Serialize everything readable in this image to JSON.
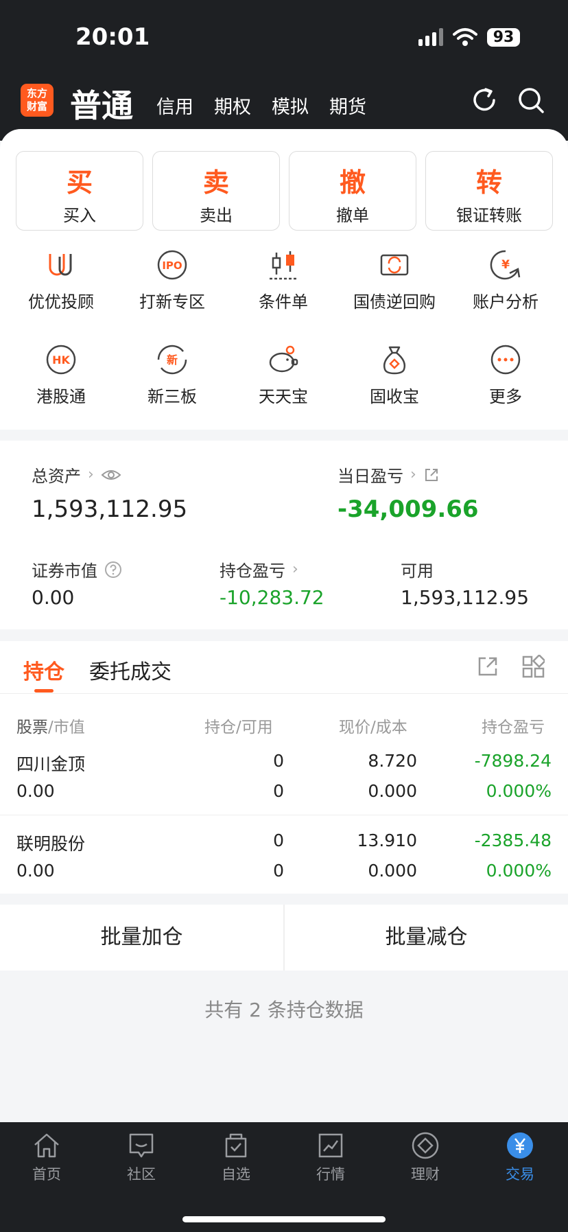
{
  "status_bar": {
    "time": "20:01",
    "battery": "93"
  },
  "header": {
    "logo_lines": [
      "东方",
      "财富"
    ],
    "active_tab": "普通",
    "tabs": [
      "信用",
      "期权",
      "模拟",
      "期货"
    ]
  },
  "actions": [
    {
      "big": "买",
      "label": "买入"
    },
    {
      "big": "卖",
      "label": "卖出"
    },
    {
      "big": "撤",
      "label": "撤单"
    },
    {
      "big": "转",
      "label": "银证转账"
    }
  ],
  "features": [
    {
      "label": "优优投顾",
      "icon": "uu-advisor-icon"
    },
    {
      "label": "打新专区",
      "icon": "ipo-icon"
    },
    {
      "label": "条件单",
      "icon": "candlestick-icon"
    },
    {
      "label": "国债逆回购",
      "icon": "repo-icon"
    },
    {
      "label": "账户分析",
      "icon": "account-analysis-icon"
    },
    {
      "label": "港股通",
      "icon": "hk-icon"
    },
    {
      "label": "新三板",
      "icon": "new-board-icon"
    },
    {
      "label": "天天宝",
      "icon": "piggy-bank-icon"
    },
    {
      "label": "固收宝",
      "icon": "money-bag-icon"
    },
    {
      "label": "更多",
      "icon": "more-icon"
    }
  ],
  "feature_icon_texts": {
    "ipo": "IPO",
    "hk": "HK",
    "new": "新",
    "yen": "¥"
  },
  "assets": {
    "total_label": "总资产",
    "total_value": "1,593,112.95",
    "daily_pl_label": "当日盈亏",
    "daily_pl_value": "-34,009.66",
    "market_value_label": "证券市值",
    "market_value": "0.00",
    "position_pl_label": "持仓盈亏",
    "position_pl_value": "-10,283.72",
    "available_label": "可用",
    "available_value": "1,593,112.95"
  },
  "holdings": {
    "tab_positions": "持仓",
    "tab_orders": "委托成交",
    "headers": [
      {
        "main": "股票",
        "sub": "市值"
      },
      {
        "main": "持仓",
        "sub": "可用"
      },
      {
        "main": "现价",
        "sub": "成本"
      },
      {
        "main": "持仓盈亏",
        "sub": ""
      }
    ],
    "rows": [
      {
        "name": "四川金顶",
        "market_value": "0.00",
        "position": "0",
        "available": "0",
        "price": "8.720",
        "cost": "0.000",
        "pl": "-7898.24",
        "pl_pct": "0.000%"
      },
      {
        "name": "联明股份",
        "market_value": "0.00",
        "position": "0",
        "available": "0",
        "price": "13.910",
        "cost": "0.000",
        "pl": "-2385.48",
        "pl_pct": "0.000%"
      }
    ]
  },
  "batch": {
    "add": "批量加仓",
    "reduce": "批量减仓"
  },
  "summary": "共有 2 条持仓数据",
  "tabbar": [
    {
      "label": "首页",
      "icon": "home-icon"
    },
    {
      "label": "社区",
      "icon": "community-icon"
    },
    {
      "label": "自选",
      "icon": "watchlist-icon"
    },
    {
      "label": "行情",
      "icon": "market-icon"
    },
    {
      "label": "理财",
      "icon": "wealth-icon"
    },
    {
      "label": "交易",
      "icon": "trade-icon",
      "active": true
    }
  ],
  "colors": {
    "accent": "#ff5a1f",
    "loss_green": "#1aa32a",
    "active_blue": "#3a8ee8"
  }
}
